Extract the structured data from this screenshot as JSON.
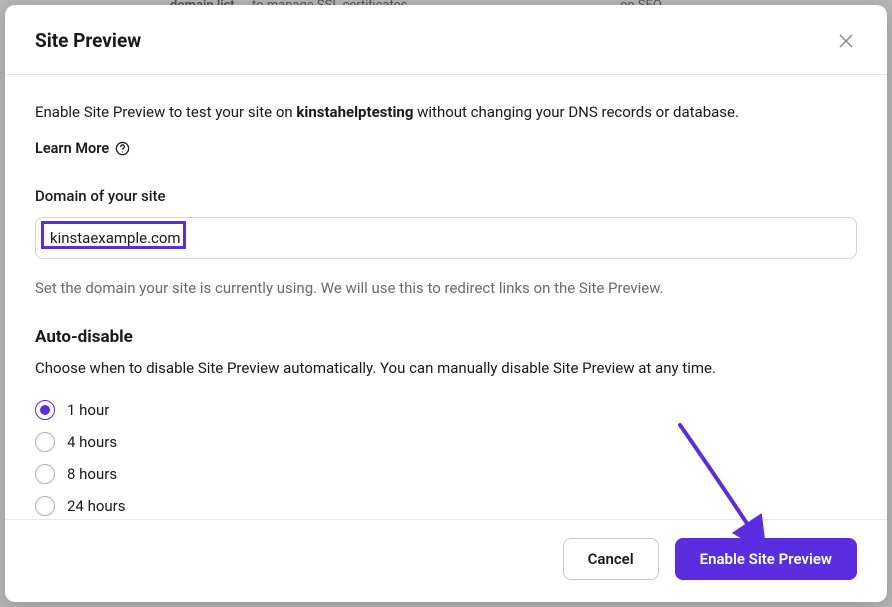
{
  "modal": {
    "title": "Site Preview",
    "intro_prefix": "Enable Site Preview to test your site on ",
    "intro_bold": "kinstahelptesting",
    "intro_suffix": " without changing your DNS records or database.",
    "learn_more": "Learn More",
    "domain": {
      "label": "Domain of your site",
      "value": "kinstaexample.com",
      "helper": "Set the domain your site is currently using. We will use this to redirect links on the Site Preview."
    },
    "auto_disable": {
      "heading": "Auto-disable",
      "description": "Choose when to disable Site Preview automatically. You can manually disable Site Preview at any time.",
      "selected": "1h",
      "options": [
        {
          "id": "1h",
          "label": "1 hour"
        },
        {
          "id": "4h",
          "label": "4 hours"
        },
        {
          "id": "8h",
          "label": "8 hours"
        },
        {
          "id": "24h",
          "label": "24 hours"
        }
      ]
    },
    "footer": {
      "cancel": "Cancel",
      "submit": "Enable Site Preview"
    }
  },
  "backdrop": {
    "snippet1": "domain list",
    "snippet2": "to manage SSL certificates",
    "snippet3": "on SEO"
  }
}
